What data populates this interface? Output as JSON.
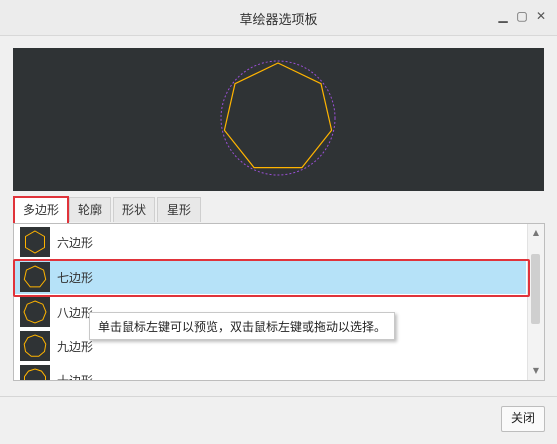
{
  "window": {
    "title": "草绘器选项板",
    "min_icon": "minimize-icon",
    "max_icon": "maximize-icon",
    "close_icon": "close-icon"
  },
  "preview": {
    "shape": "heptagon",
    "stroke_color": "#ffb400",
    "circle_color": "#9a4fd6",
    "background": "#2f3335"
  },
  "tabs": [
    {
      "label": "多边形",
      "active": true
    },
    {
      "label": "轮廓",
      "active": false
    },
    {
      "label": "形状",
      "active": false
    },
    {
      "label": "星形",
      "active": false
    }
  ],
  "list": {
    "items": [
      {
        "label": "六边形",
        "sides": 6,
        "selected": false
      },
      {
        "label": "七边形",
        "sides": 7,
        "selected": true
      },
      {
        "label": "八边形",
        "sides": 8,
        "selected": false
      },
      {
        "label": "九边形",
        "sides": 9,
        "selected": false
      },
      {
        "label": "十边形",
        "sides": 10,
        "selected": false
      }
    ],
    "selection_color": "#b6e2f8"
  },
  "tooltip": {
    "text": "单击鼠标左键可以预览，双击鼠标左键或拖动以选择。"
  },
  "footer": {
    "close_label": "关闭"
  }
}
